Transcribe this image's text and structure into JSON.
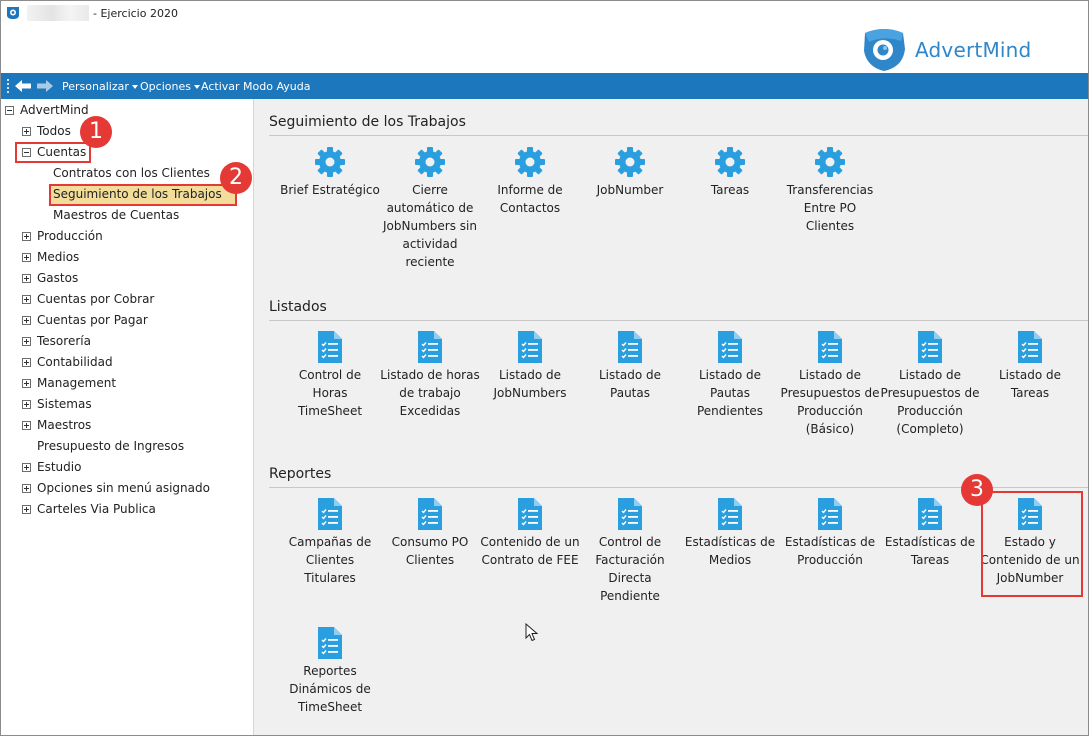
{
  "window": {
    "title": "- Ejercicio 2020"
  },
  "logo": {
    "brand_light": "Advert",
    "brand_bold": "Mind",
    "color": "#2f86c8"
  },
  "toolbar": {
    "personalizar": "Personalizar",
    "opciones": "Opciones",
    "ayuda": "Activar Modo Ayuda",
    "bg_color": "#1d77bc"
  },
  "tree": {
    "root": "AdvertMind",
    "todos": "Todos",
    "cuentas": "Cuentas",
    "cuentas_children": [
      "Contratos con los Clientes",
      "Seguimiento de los Trabajos",
      "Maestros de Cuentas"
    ],
    "items": [
      "Producción",
      "Medios",
      "Gastos",
      "Cuentas por Cobrar",
      "Cuentas por Pagar",
      "Tesorería",
      "Contabilidad",
      "Management",
      "Sistemas",
      "Maestros",
      "Presupuesto de Ingresos",
      "Estudio",
      "Opciones sin menú asignado",
      "Carteles Via Publica"
    ]
  },
  "badges": [
    "1",
    "2",
    "3"
  ],
  "sections": {
    "seguimiento": {
      "title": "Seguimiento de los Trabajos",
      "tiles": [
        {
          "label": "Brief Estratégico",
          "icon": "gear-icon"
        },
        {
          "label": "Cierre automático de JobNumbers sin actividad reciente",
          "icon": "gear-icon"
        },
        {
          "label": "Informe de Contactos",
          "icon": "gear-icon"
        },
        {
          "label": "JobNumber",
          "icon": "gear-icon"
        },
        {
          "label": "Tareas",
          "icon": "gear-icon"
        },
        {
          "label": "Transferencias Entre PO Clientes",
          "icon": "gear-icon"
        }
      ]
    },
    "listados": {
      "title": "Listados",
      "tiles": [
        {
          "label": "Control de Horas TimeSheet",
          "icon": "document-list-icon"
        },
        {
          "label": "Listado de horas de trabajo Excedidas",
          "icon": "document-list-icon"
        },
        {
          "label": "Listado de JobNumbers",
          "icon": "document-list-icon"
        },
        {
          "label": "Listado de Pautas",
          "icon": "document-list-icon"
        },
        {
          "label": "Listado de Pautas Pendientes",
          "icon": "document-list-icon"
        },
        {
          "label": "Listado de Presupuestos de Producción (Básico)",
          "icon": "document-list-icon"
        },
        {
          "label": "Listado de Presupuestos de Producción (Completo)",
          "icon": "document-list-icon"
        },
        {
          "label": "Listado de Tareas",
          "icon": "document-list-icon"
        }
      ]
    },
    "reportes": {
      "title": "Reportes",
      "tiles": [
        {
          "label": "Campañas de Clientes Titulares",
          "icon": "document-list-icon"
        },
        {
          "label": "Consumo PO Clientes",
          "icon": "document-list-icon"
        },
        {
          "label": "Contenido de un Contrato de FEE",
          "icon": "document-list-icon"
        },
        {
          "label": "Control de Facturación Directa Pendiente",
          "icon": "document-list-icon"
        },
        {
          "label": "Estadísticas de Medios",
          "icon": "document-list-icon"
        },
        {
          "label": "Estadísticas de Producción",
          "icon": "document-list-icon"
        },
        {
          "label": "Estadísticas de Tareas",
          "icon": "document-list-icon"
        },
        {
          "label": "Estado y Contenido de un JobNumber",
          "icon": "document-list-icon"
        },
        {
          "label": "Reportes Dinámicos de TimeSheet",
          "icon": "document-list-icon"
        }
      ]
    }
  },
  "colors": {
    "icon_blue": "#2a9fe0",
    "highlight_red": "#e53935",
    "selection_yellow": "#f2dd9a"
  }
}
